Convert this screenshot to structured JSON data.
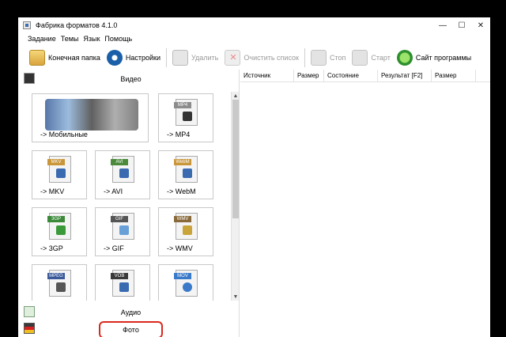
{
  "window": {
    "title": "Фабрика форматов 4.1.0"
  },
  "winbtns": {
    "minimize": "—",
    "maximize": "☐",
    "close": "✕"
  },
  "menu": [
    "Задание",
    "Темы",
    "Язык",
    "Помощь"
  ],
  "toolbar": {
    "output_folder": "Конечная папка",
    "settings": "Настройки",
    "delete": "Удалить",
    "clear_list": "Очистить список",
    "stop": "Стоп",
    "start": "Старт",
    "website": "Сайт программы"
  },
  "categories": {
    "video": "Видео",
    "audio": "Аудио",
    "photo": "Фото"
  },
  "tiles": [
    {
      "label": "-> Мобильные",
      "icon": "mobile-devices-icon"
    },
    {
      "label": "-> MP4",
      "icon": "mp4-file-icon",
      "tag": "MP4",
      "color": "#8c8c8c"
    },
    {
      "label": "-> MKV",
      "icon": "mkv-file-icon",
      "tag": "MKV",
      "color": "#c9963a"
    },
    {
      "label": "-> AVI",
      "icon": "avi-file-icon",
      "tag": "AVI",
      "color": "#4a8a3a"
    },
    {
      "label": "-> WebM",
      "icon": "webm-file-icon",
      "tag": "WebM",
      "color": "#c9963a"
    },
    {
      "label": "-> 3GP",
      "icon": "3gp-file-icon",
      "tag": "3GP",
      "color": "#3a8a3a"
    },
    {
      "label": "-> GIF",
      "icon": "gif-file-icon",
      "tag": "GIF",
      "color": "#555555"
    },
    {
      "label": "-> WMV",
      "icon": "wmv-file-icon",
      "tag": "WMV",
      "color": "#8a6a3a"
    },
    {
      "label": "",
      "icon": "mpeg-file-icon",
      "tag": "MPEG",
      "color": "#3a5a9a"
    },
    {
      "label": "",
      "icon": "vob-file-icon",
      "tag": "VOB",
      "color": "#3a3a3a"
    },
    {
      "label": "",
      "icon": "mov-file-icon",
      "tag": "MOV",
      "color": "#3a7ac9"
    }
  ],
  "table": {
    "columns": [
      "Источник",
      "Размер",
      "Состояние",
      "Результат [F2]",
      "Размер"
    ]
  }
}
